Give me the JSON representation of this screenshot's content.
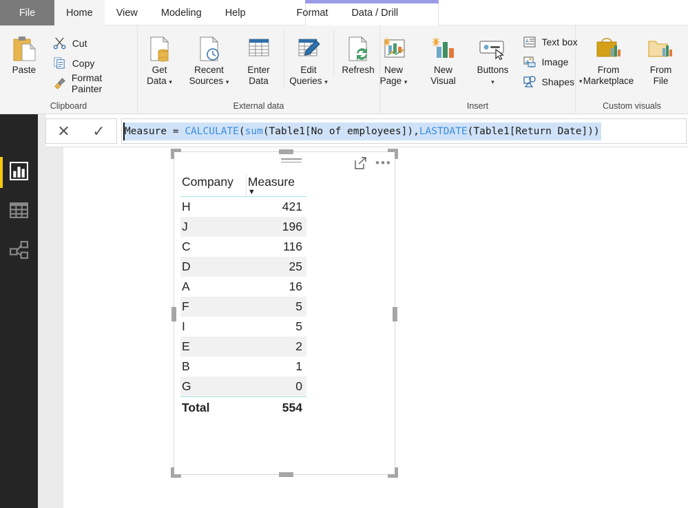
{
  "tabs": [
    {
      "label": "File",
      "state": "file"
    },
    {
      "label": "Home",
      "state": "active"
    },
    {
      "label": "View",
      "state": "normal"
    },
    {
      "label": "Modeling",
      "state": "normal"
    },
    {
      "label": "Help",
      "state": "normal"
    }
  ],
  "contextual_tabs": [
    {
      "label": "Format"
    },
    {
      "label": "Data / Drill"
    }
  ],
  "contextual_group_color": "#9b9be8",
  "ribbon": {
    "groups": [
      {
        "name": "Clipboard",
        "label": "Clipboard",
        "big_buttons": [
          {
            "label": "Paste",
            "icon": "paste-icon"
          }
        ],
        "small_buttons": [
          {
            "label": "Cut",
            "icon": "scissors-icon"
          },
          {
            "label": "Copy",
            "icon": "copy-icon"
          },
          {
            "label": "Format Painter",
            "icon": "paintbrush-icon"
          }
        ]
      },
      {
        "name": "External data",
        "label": "External data",
        "big_buttons": [
          {
            "label_line1": "Get",
            "label_line2": "Data",
            "icon": "get-data-icon",
            "has_caret": true
          },
          {
            "label_line1": "Recent",
            "label_line2": "Sources",
            "icon": "recent-sources-icon",
            "has_caret": true
          },
          {
            "label_line1": "Enter",
            "label_line2": "Data",
            "icon": "enter-data-icon",
            "has_caret": false
          },
          {
            "label_line1": "Edit",
            "label_line2": "Queries",
            "icon": "edit-queries-icon",
            "has_caret": true
          },
          {
            "label_line1": "Refresh",
            "label_line2": "",
            "icon": "refresh-icon",
            "has_caret": false
          }
        ]
      },
      {
        "name": "Insert",
        "label": "Insert",
        "big_buttons": [
          {
            "label_line1": "New",
            "label_line2": "Page",
            "icon": "new-page-icon",
            "has_caret": true
          },
          {
            "label_line1": "New",
            "label_line2": "Visual",
            "icon": "new-visual-icon",
            "has_caret": false
          },
          {
            "label_line1": "Buttons",
            "label_line2": "",
            "icon": "buttons-icon",
            "has_caret": true
          }
        ],
        "small_buttons": [
          {
            "label": "Text box",
            "icon": "text-box-icon",
            "has_caret": false
          },
          {
            "label": "Image",
            "icon": "image-icon",
            "has_caret": false
          },
          {
            "label": "Shapes",
            "icon": "shapes-icon",
            "has_caret": true
          }
        ]
      },
      {
        "name": "Custom visuals",
        "label": "Custom visuals",
        "big_buttons": [
          {
            "label_line1": "From",
            "label_line2": "Marketplace",
            "icon": "marketplace-icon"
          },
          {
            "label_line1": "From",
            "label_line2": "File",
            "icon": "from-file-icon"
          }
        ]
      }
    ]
  },
  "formula_bar": {
    "cancel_icon": "close-icon",
    "accept_icon": "checkmark-icon",
    "prefix": "Measure = ",
    "tokens": [
      {
        "text": "Measure = ",
        "kind": "plain"
      },
      {
        "text": "CALCULATE",
        "kind": "keyword"
      },
      {
        "text": "(",
        "kind": "plain"
      },
      {
        "text": "sum",
        "kind": "keyword"
      },
      {
        "text": "(Table1[No of employees]),",
        "kind": "plain"
      },
      {
        "text": "LASTDATE",
        "kind": "keyword"
      },
      {
        "text": "(Table1[Return Date]))",
        "kind": "plain"
      }
    ],
    "full_text": "Measure = CALCULATE(sum(Table1[No of employees]),LASTDATE(Table1[Return Date]))"
  },
  "sidebar": {
    "items": [
      {
        "name": "report-view",
        "icon": "bar-chart-icon",
        "active": true
      },
      {
        "name": "data-view",
        "icon": "table-grid-icon",
        "active": false
      },
      {
        "name": "model-view",
        "icon": "relationship-icon",
        "active": false
      }
    ],
    "accent_color": "#f2c811"
  },
  "visual": {
    "header_icons": [
      {
        "name": "filter-menu-icon"
      },
      {
        "name": "focus-mode-icon"
      },
      {
        "name": "more-options-icon",
        "glyph": "• • •"
      }
    ],
    "table": {
      "columns": [
        "Company",
        "Measure"
      ],
      "sort_column": "Measure",
      "sort_direction": "descending",
      "rows": [
        {
          "company": "H",
          "measure": "421"
        },
        {
          "company": "J",
          "measure": "196"
        },
        {
          "company": "C",
          "measure": "116"
        },
        {
          "company": "D",
          "measure": "25"
        },
        {
          "company": "A",
          "measure": "16"
        },
        {
          "company": "F",
          "measure": "5"
        },
        {
          "company": "I",
          "measure": "5"
        },
        {
          "company": "E",
          "measure": "2"
        },
        {
          "company": "B",
          "measure": "1"
        },
        {
          "company": "G",
          "measure": "0"
        }
      ],
      "total_label": "Total",
      "total_value": "554"
    }
  }
}
